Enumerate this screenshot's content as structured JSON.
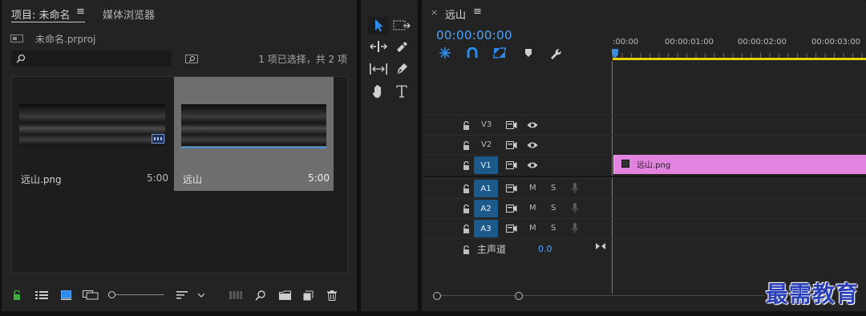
{
  "project_panel": {
    "tab_project": "项目: 未命名",
    "tab_menu_icon": "≡",
    "tab_media_browser": "媒体浏览器",
    "project_file": "未命名.prproj",
    "search": {
      "placeholder": "",
      "value": ""
    },
    "selection_status": "1 项已选择，共 2 项",
    "items": [
      {
        "name": "远山.png",
        "duration": "5:00"
      },
      {
        "name": "远山",
        "duration": "5:00"
      }
    ]
  },
  "tools": [
    "selection-tool",
    "track-select-tool",
    "ripple-edit-tool",
    "razor-tool",
    "slip-tool",
    "pen-tool",
    "hand-tool",
    "type-tool"
  ],
  "timeline": {
    "close_icon": "×",
    "tab_label": "远山",
    "tab_menu_icon": "≡",
    "timecode": "00:00:00:00",
    "ruler_labels": [
      ":00:00",
      "00:00:01:00",
      "00:00:02:00",
      "00:00:03:00"
    ],
    "video_tracks": [
      {
        "name": "V3",
        "selected": false
      },
      {
        "name": "V2",
        "selected": false
      },
      {
        "name": "V1",
        "selected": true
      }
    ],
    "audio_tracks": [
      {
        "name": "A1",
        "mute": "M",
        "solo": "S"
      },
      {
        "name": "A2",
        "mute": "M",
        "solo": "S"
      },
      {
        "name": "A3",
        "mute": "M",
        "solo": "S"
      }
    ],
    "master": {
      "label": "主声道",
      "value": "0.0"
    },
    "clip": {
      "name": "远山.png",
      "color": "#e383e0"
    }
  },
  "watermark": "最需教育",
  "colors": {
    "accent": "#2d8ceb",
    "timecode": "#4aa3ff",
    "playhead": "#3d8bd9",
    "work_area": "#e8d000"
  }
}
